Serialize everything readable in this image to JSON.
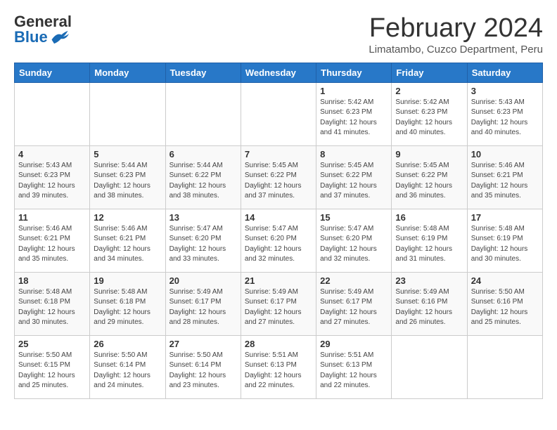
{
  "header": {
    "logo_general": "General",
    "logo_blue": "Blue",
    "title": "February 2024",
    "subtitle": "Limatambo, Cuzco Department, Peru"
  },
  "weekdays": [
    "Sunday",
    "Monday",
    "Tuesday",
    "Wednesday",
    "Thursday",
    "Friday",
    "Saturday"
  ],
  "weeks": [
    [
      {
        "day": "",
        "info": ""
      },
      {
        "day": "",
        "info": ""
      },
      {
        "day": "",
        "info": ""
      },
      {
        "day": "",
        "info": ""
      },
      {
        "day": "1",
        "info": "Sunrise: 5:42 AM\nSunset: 6:23 PM\nDaylight: 12 hours\nand 41 minutes."
      },
      {
        "day": "2",
        "info": "Sunrise: 5:42 AM\nSunset: 6:23 PM\nDaylight: 12 hours\nand 40 minutes."
      },
      {
        "day": "3",
        "info": "Sunrise: 5:43 AM\nSunset: 6:23 PM\nDaylight: 12 hours\nand 40 minutes."
      }
    ],
    [
      {
        "day": "4",
        "info": "Sunrise: 5:43 AM\nSunset: 6:23 PM\nDaylight: 12 hours\nand 39 minutes."
      },
      {
        "day": "5",
        "info": "Sunrise: 5:44 AM\nSunset: 6:23 PM\nDaylight: 12 hours\nand 38 minutes."
      },
      {
        "day": "6",
        "info": "Sunrise: 5:44 AM\nSunset: 6:22 PM\nDaylight: 12 hours\nand 38 minutes."
      },
      {
        "day": "7",
        "info": "Sunrise: 5:45 AM\nSunset: 6:22 PM\nDaylight: 12 hours\nand 37 minutes."
      },
      {
        "day": "8",
        "info": "Sunrise: 5:45 AM\nSunset: 6:22 PM\nDaylight: 12 hours\nand 37 minutes."
      },
      {
        "day": "9",
        "info": "Sunrise: 5:45 AM\nSunset: 6:22 PM\nDaylight: 12 hours\nand 36 minutes."
      },
      {
        "day": "10",
        "info": "Sunrise: 5:46 AM\nSunset: 6:21 PM\nDaylight: 12 hours\nand 35 minutes."
      }
    ],
    [
      {
        "day": "11",
        "info": "Sunrise: 5:46 AM\nSunset: 6:21 PM\nDaylight: 12 hours\nand 35 minutes."
      },
      {
        "day": "12",
        "info": "Sunrise: 5:46 AM\nSunset: 6:21 PM\nDaylight: 12 hours\nand 34 minutes."
      },
      {
        "day": "13",
        "info": "Sunrise: 5:47 AM\nSunset: 6:20 PM\nDaylight: 12 hours\nand 33 minutes."
      },
      {
        "day": "14",
        "info": "Sunrise: 5:47 AM\nSunset: 6:20 PM\nDaylight: 12 hours\nand 32 minutes."
      },
      {
        "day": "15",
        "info": "Sunrise: 5:47 AM\nSunset: 6:20 PM\nDaylight: 12 hours\nand 32 minutes."
      },
      {
        "day": "16",
        "info": "Sunrise: 5:48 AM\nSunset: 6:19 PM\nDaylight: 12 hours\nand 31 minutes."
      },
      {
        "day": "17",
        "info": "Sunrise: 5:48 AM\nSunset: 6:19 PM\nDaylight: 12 hours\nand 30 minutes."
      }
    ],
    [
      {
        "day": "18",
        "info": "Sunrise: 5:48 AM\nSunset: 6:18 PM\nDaylight: 12 hours\nand 30 minutes."
      },
      {
        "day": "19",
        "info": "Sunrise: 5:48 AM\nSunset: 6:18 PM\nDaylight: 12 hours\nand 29 minutes."
      },
      {
        "day": "20",
        "info": "Sunrise: 5:49 AM\nSunset: 6:17 PM\nDaylight: 12 hours\nand 28 minutes."
      },
      {
        "day": "21",
        "info": "Sunrise: 5:49 AM\nSunset: 6:17 PM\nDaylight: 12 hours\nand 27 minutes."
      },
      {
        "day": "22",
        "info": "Sunrise: 5:49 AM\nSunset: 6:17 PM\nDaylight: 12 hours\nand 27 minutes."
      },
      {
        "day": "23",
        "info": "Sunrise: 5:49 AM\nSunset: 6:16 PM\nDaylight: 12 hours\nand 26 minutes."
      },
      {
        "day": "24",
        "info": "Sunrise: 5:50 AM\nSunset: 6:16 PM\nDaylight: 12 hours\nand 25 minutes."
      }
    ],
    [
      {
        "day": "25",
        "info": "Sunrise: 5:50 AM\nSunset: 6:15 PM\nDaylight: 12 hours\nand 25 minutes."
      },
      {
        "day": "26",
        "info": "Sunrise: 5:50 AM\nSunset: 6:14 PM\nDaylight: 12 hours\nand 24 minutes."
      },
      {
        "day": "27",
        "info": "Sunrise: 5:50 AM\nSunset: 6:14 PM\nDaylight: 12 hours\nand 23 minutes."
      },
      {
        "day": "28",
        "info": "Sunrise: 5:51 AM\nSunset: 6:13 PM\nDaylight: 12 hours\nand 22 minutes."
      },
      {
        "day": "29",
        "info": "Sunrise: 5:51 AM\nSunset: 6:13 PM\nDaylight: 12 hours\nand 22 minutes."
      },
      {
        "day": "",
        "info": ""
      },
      {
        "day": "",
        "info": ""
      }
    ]
  ]
}
